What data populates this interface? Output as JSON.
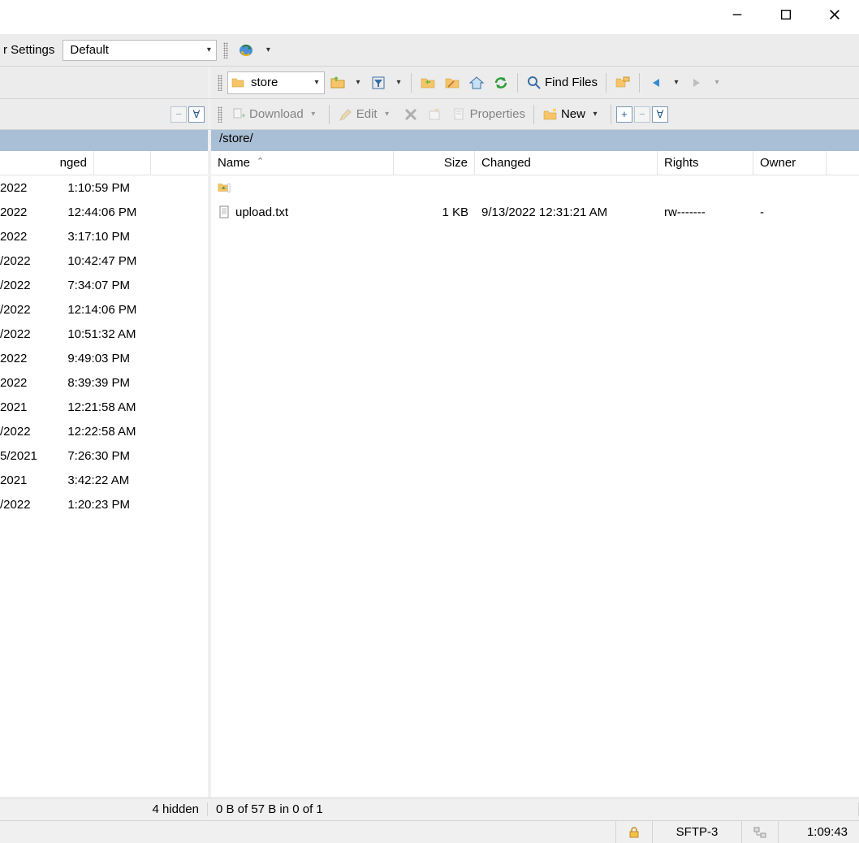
{
  "window": {
    "minimize": "—",
    "maximize": "☐",
    "close": "✕"
  },
  "settings_bar": {
    "label_suffix": "r Settings",
    "preset": "Default"
  },
  "remote_toolbar": {
    "path_combo": "store",
    "find_files_label": "Find Files"
  },
  "download_bar": {
    "download_label": "Download",
    "edit_label": "Edit",
    "properties_label": "Properties",
    "new_label": "New",
    "plus": "+",
    "minus": "−",
    "select": "∀"
  },
  "path": {
    "remote": "/store/"
  },
  "left_pane": {
    "header_changed_suffix": "nged",
    "rows": [
      {
        "date": "2022",
        "time": "1:10:59 PM"
      },
      {
        "date": "2022",
        "time": "12:44:06 PM"
      },
      {
        "date": "2022",
        "time": "3:17:10 PM"
      },
      {
        "date": "/2022",
        "time": "10:42:47 PM"
      },
      {
        "date": "/2022",
        "time": "7:34:07 PM"
      },
      {
        "date": "/2022",
        "time": "12:14:06 PM"
      },
      {
        "date": "/2022",
        "time": "10:51:32 AM"
      },
      {
        "date": "2022",
        "time": "9:49:03 PM"
      },
      {
        "date": "2022",
        "time": "8:39:39 PM"
      },
      {
        "date": "2021",
        "time": "12:21:58 AM"
      },
      {
        "date": "/2022",
        "time": "12:22:58 AM"
      },
      {
        "date": "5/2021",
        "time": "7:26:30 PM"
      },
      {
        "date": "2021",
        "time": "3:42:22 AM"
      },
      {
        "date": "/2022",
        "time": "1:20:23 PM"
      }
    ]
  },
  "remote_pane": {
    "columns": {
      "name": "Name",
      "size": "Size",
      "changed": "Changed",
      "rights": "Rights",
      "owner": "Owner"
    },
    "files": [
      {
        "icon": "folder-up",
        "name": "",
        "size": "",
        "changed": "",
        "rights": "",
        "owner": ""
      },
      {
        "icon": "text-file",
        "name": "upload.txt",
        "size": "1 KB",
        "changed": "9/13/2022 12:31:21 AM",
        "rights": "rw-------",
        "owner": "-"
      }
    ]
  },
  "status": {
    "left_hidden": "4 hidden",
    "right_selection": "0 B of 57 B in 0 of 1"
  },
  "bottom": {
    "protocol": "SFTP-3",
    "elapsed": "1:09:43"
  }
}
